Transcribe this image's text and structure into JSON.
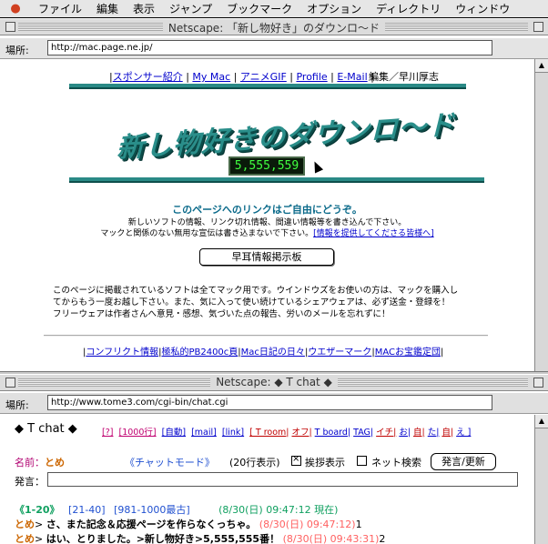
{
  "menubar": {
    "apple_icon": "apple-icon",
    "items": [
      "ファイル",
      "編集",
      "表示",
      "ジャンプ",
      "ブックマーク",
      "オプション",
      "ディレクトリ",
      "ウィンドウ"
    ]
  },
  "window1": {
    "title": "Netscape: 「新し物好き」のダウンロ〜ド",
    "location_label": "場所:",
    "location_url": "http://mac.page.ne.jp/"
  },
  "page1": {
    "nav_links": [
      "スポンサー紹介",
      "My Mac",
      "アニメGIF",
      "Profile",
      "E-Mail"
    ],
    "editor": "編集／早川厚志",
    "logo_text": "新し物好きのダウンロ〜ド",
    "counter": "5,555,559",
    "invite_head": "このページへのリンクはご自由にどうぞ。",
    "invite_line1": "新しいソフトの情報、リンク切れ情報、間違い情報等を書き込んで下さい。",
    "invite_line2_pre": "マックと関係のない無用な宣伝は書き込まないで下さい。",
    "invite_line2_link": "[情報を提供してくださる皆様へ]",
    "board_button": "早耳情報掲示板",
    "para_1": "このページに掲載されているソフトは全てマック用です。ウインドウズをお使いの方は、マックを購入し",
    "para_2": "てからもう一度お越し下さい。また、気に入って使い続けているシェアウェアは、必ず送金・登録を！",
    "para_3": "フリーウェアは作者さんへ意見・感想、気づいた点の報告、労いのメールを忘れずに！",
    "bottom_links": [
      "コンフリクト情報",
      "極私的PB2400c頁",
      "Mac日記の日々",
      "ウエザーマーク",
      "MACお宝鑑定団"
    ]
  },
  "window2": {
    "title": "Netscape: ◆ T chat ◆",
    "location_label": "場所:",
    "location_url": "http://www.tome3.com/cgi-bin/chat.cgi"
  },
  "chat": {
    "title": "◆ T chat ◆",
    "links": [
      "[?]",
      "[1000行]",
      "[自動]",
      "[mail]",
      "[link]",
      "[ T room|",
      "オフ|",
      "T board|",
      "TAG|",
      "イチ|",
      "お|",
      "自|",
      "た|",
      "自|",
      "え ]"
    ],
    "name_label": "名前：",
    "name_value": "とめ",
    "mode": "《チャットモード》",
    "lines_display": "(20行表示)",
    "greet_label": "挨拶表示",
    "net_search_label": "ネット検索",
    "post_button": "発言/更新",
    "message_label": "発言：",
    "pager_current": "《1-20》",
    "pager_links": [
      "[21-40]",
      "[981-1000最古]"
    ],
    "now_time": "(8/30(日) 09:47:12 現在)",
    "messages": [
      {
        "who": "とめ",
        "arrow": ">",
        "text": "さ、また記念＆応援ページを作らなくっちゃ。",
        "time": "(8/30(日) 09:47:12)",
        "num": "1"
      },
      {
        "who": "とめ",
        "arrow": ">",
        "text": "はい、とりました。>新し物好き>5,555,555番！",
        "time": "(8/30(日) 09:43:31)",
        "num": "2"
      }
    ]
  }
}
